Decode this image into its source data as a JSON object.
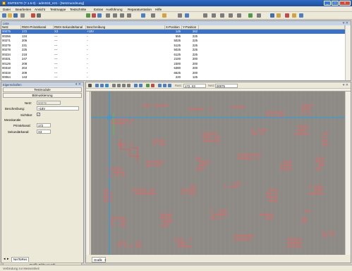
{
  "window": {
    "title": "EMTEST0 (7.1.6.0) - adm033_n21 - [Netzzuordnung]"
  },
  "menu": [
    "Datei",
    "Bearbeiten",
    "Ansicht",
    "Testmappe",
    "Testschritte",
    "Extras",
    "Ausführung",
    "Reparaturstation",
    "Hilfe"
  ],
  "table": {
    "pane_title": "Liste",
    "columns": [
      "Netz",
      "RWX-Primärkanal",
      "RWX-Sekundärkanal",
      "Beschreibung",
      "X-Position",
      "Y-Position"
    ],
    "rows": [
      [
        "00075",
        "172",
        "X3",
        "+18V",
        "145",
        "262"
      ],
      [
        "00256",
        "134",
        "---",
        "-",
        "555",
        "225"
      ],
      [
        "00271",
        "206",
        "---",
        "-",
        "5025",
        "225"
      ],
      [
        "00279",
        "231",
        "---",
        "-",
        "5125",
        "225"
      ],
      [
        "00278",
        "225",
        "---",
        "-",
        "5025",
        "225"
      ],
      [
        "00234",
        "218",
        "---",
        "-",
        "6125",
        "225"
      ],
      [
        "00331",
        "247",
        "---",
        "-",
        "2100",
        "200"
      ],
      [
        "00129",
        "208",
        "---",
        "-",
        "2300",
        "200"
      ],
      [
        "00318",
        "204",
        "---",
        "-",
        "6380",
        "200"
      ],
      [
        "00319",
        "209",
        "---",
        "-",
        "6625",
        "200"
      ],
      [
        "00064",
        "143",
        "---",
        "-",
        "220",
        "125"
      ]
    ]
  },
  "panel": {
    "title": "Eigenschaften",
    "btn_testmodule": "Testmodule",
    "btn_bitmuskierung": "Bitmuskierung",
    "netz_label": "Netz:",
    "netz_value": "00075",
    "beschreibung_label": "Beschreibung:",
    "beschreibung_value": "+18V",
    "sichtbar_label": "Sichtbar:",
    "sichtbar_checked": "✓",
    "messkanaele_label": "Messkanäle",
    "primaer_label": "Primärkanal:",
    "primaer_value": "172",
    "sekundaer_label": "Sekundärkanal:",
    "sekundaer_value": "X3",
    "tab_netzliste": "NetToRes",
    "tab_grafik": "Grafik-Bildauswahl"
  },
  "graphics": {
    "tab": "Grafik",
    "coord_x_label": "Rast:",
    "coord_x_value": "172, X3",
    "coord_y_label": "Netz:",
    "coord_y_value": "00075",
    "canvas_bg": "#8e8b86",
    "crosshair_color": "#1da0e8",
    "pin_color": "#ff5b5b"
  },
  "status": {
    "left": "Verbindung zur Messeinheit",
    "mid1": "",
    "mid2": "",
    "right1": "",
    "right2": ""
  }
}
